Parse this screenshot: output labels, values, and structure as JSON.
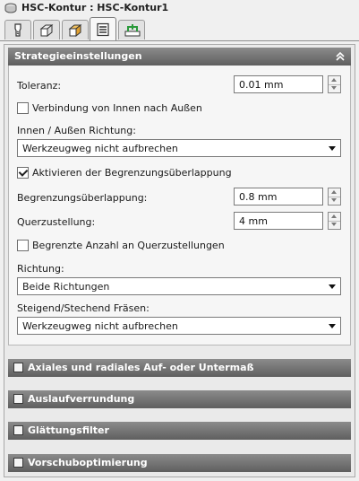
{
  "window": {
    "title": "HSC-Kontur : HSC-Kontur1",
    "title_icon": "tool-holder-icon"
  },
  "tabs": [
    {
      "icon": "tool-icon",
      "active": false
    },
    {
      "icon": "stock-box-icon",
      "active": false
    },
    {
      "icon": "model-box-icon",
      "active": false
    },
    {
      "icon": "strategy-list-icon",
      "active": true
    },
    {
      "icon": "linking-icon",
      "active": false
    }
  ],
  "strategy_section": {
    "title": "Strategieeinstellungen",
    "collapse_icon": "double-chevron-up-icon",
    "toleranz": {
      "label": "Toleranz:",
      "value": "0.01 mm"
    },
    "verbindung_checkbox": {
      "label": "Verbindung von Innen nach Außen",
      "checked": false
    },
    "innen_aussen": {
      "label": "Innen / Außen Richtung:",
      "selected": "Werkzeugweg nicht aufbrechen"
    },
    "aktivieren_checkbox": {
      "label": "Aktivieren der Begrenzungsüberlappung",
      "checked": true
    },
    "begrenzungsueberlappung": {
      "label": "Begrenzungsüberlappung:",
      "value": "0.8 mm"
    },
    "querzustellung": {
      "label": "Querzustellung:",
      "value": "4 mm"
    },
    "begrenzte_checkbox": {
      "label": "Begrenzte Anzahl an Querzustellungen",
      "checked": false
    },
    "richtung": {
      "label": "Richtung:",
      "selected": "Beide Richtungen"
    },
    "steigend": {
      "label": "Steigend/Stechend Fräsen:",
      "selected": "Werkzeugweg nicht aufbrechen"
    }
  },
  "collapsed_sections": [
    {
      "title": "Axiales und radiales Auf- oder Untermaß",
      "checked": false
    },
    {
      "title": "Auslaufverrundung",
      "checked": false
    },
    {
      "title": "Glättungsfilter",
      "checked": false
    },
    {
      "title": "Vorschuboptimierung",
      "checked": false
    }
  ],
  "colors": {
    "header_top": "#8b8b8b",
    "header_bottom": "#5f5f5f",
    "panel_bg": "#f6f6f6"
  }
}
